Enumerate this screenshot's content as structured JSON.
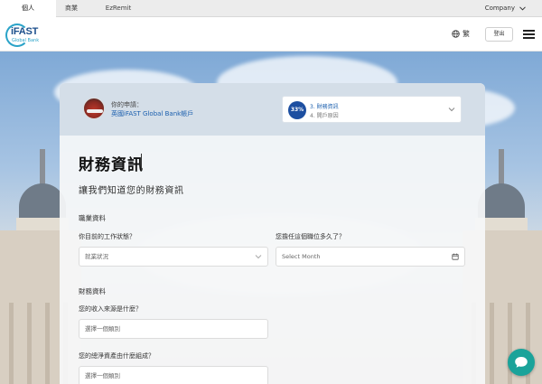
{
  "topbar": {
    "tabs": [
      {
        "label": "個人",
        "active": true
      },
      {
        "label": "商業",
        "active": false
      },
      {
        "label": "EzRemit",
        "active": false
      }
    ],
    "company_label": "Company"
  },
  "header": {
    "logo_text": "iFAST",
    "logo_sub": "Global Bank",
    "lang_label": "繁",
    "logout_label": "登出"
  },
  "card": {
    "application_label": "你的申請：",
    "application_name": "英國iFAST Global Bank帳戶",
    "progress_percent": "33%",
    "step_current": "3. 財務資訊",
    "step_next": "4. 開戶原因"
  },
  "form": {
    "title": "財務資訊",
    "subtitle": "讓我們知道您的財務資訊",
    "employment": {
      "group_label": "職業資料",
      "status_label": "你目前的工作狀態？",
      "status_placeholder": "就業狀況",
      "tenure_label": "您擔任這個職位多久了？",
      "tenure_placeholder": "Select Month"
    },
    "finance": {
      "group_label": "財務資料",
      "income_label": "您的收入來源是什麼？",
      "income_placeholder": "選擇一個類別",
      "networth_label": "您的總淨資產由什麼組成？",
      "networth_placeholder": "選擇一個類別"
    }
  },
  "colors": {
    "accent": "#1d4fa1",
    "link": "#1b5fae",
    "chat": "#1aa39a"
  }
}
